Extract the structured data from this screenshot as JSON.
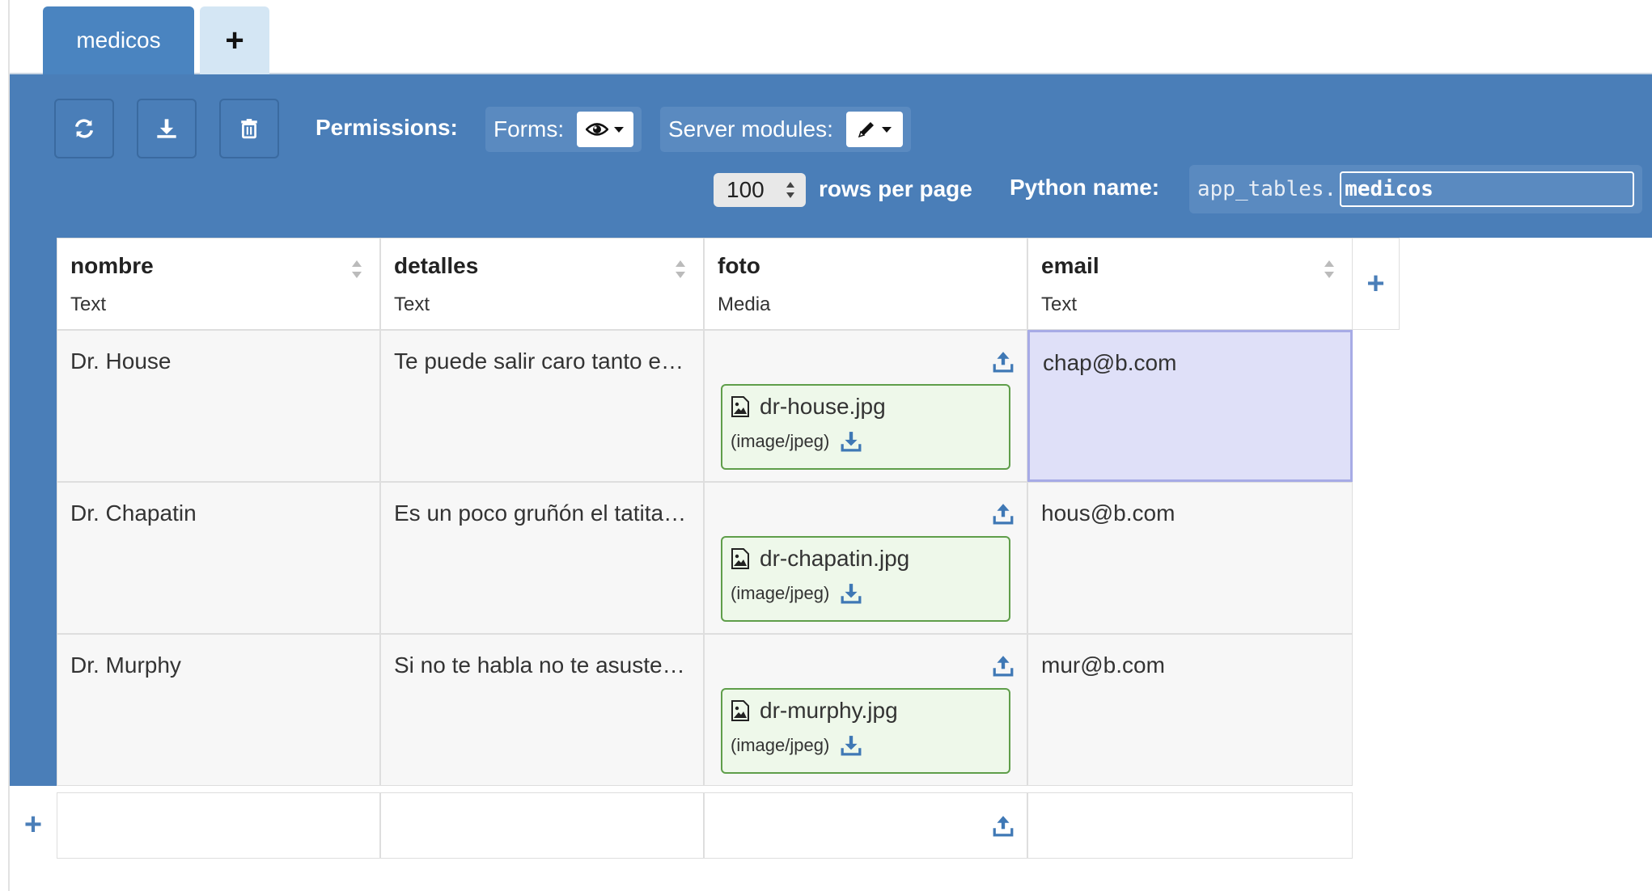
{
  "tabs": [
    {
      "label": "medicos",
      "active": true
    },
    {
      "label": "+",
      "active": false
    }
  ],
  "toolbar": {
    "refresh_icon": "refresh-icon",
    "download_icon": "download-icon",
    "delete_icon": "trash-icon",
    "permissions_label": "Permissions:",
    "forms_label": "Forms:",
    "forms_value_icon": "eye-icon",
    "server_modules_label": "Server modules:",
    "server_modules_value_icon": "pencil-icon",
    "rows_per_page_value": "100",
    "rows_per_page_label": "rows per page",
    "python_name_label": "Python name:",
    "python_prefix": "app_tables.",
    "python_name_value": "medicos"
  },
  "columns": [
    {
      "name": "nombre",
      "type": "Text",
      "sortable": true
    },
    {
      "name": "detalles",
      "type": "Text",
      "sortable": true
    },
    {
      "name": "foto",
      "type": "Media",
      "sortable": false
    },
    {
      "name": "email",
      "type": "Text",
      "sortable": true
    }
  ],
  "add_column_label": "+",
  "rows": [
    {
      "nombre": "Dr. House",
      "detalles": "Te puede salir caro tanto e…",
      "foto": {
        "name": "dr-house.jpg",
        "type": "(image/jpeg)"
      },
      "email": "chap@b.com",
      "selected_col": "email"
    },
    {
      "nombre": "Dr. Chapatin",
      "detalles": "Es un poco gruñón el tatita…",
      "foto": {
        "name": "dr-chapatin.jpg",
        "type": "(image/jpeg)"
      },
      "email": "hous@b.com"
    },
    {
      "nombre": "Dr. Murphy",
      "detalles": "Si no te habla no te asuste…",
      "foto": {
        "name": "dr-murphy.jpg",
        "type": "(image/jpeg)"
      },
      "email": "mur@b.com"
    }
  ],
  "add_row_label": "+",
  "colors": {
    "accent": "#4a7eb8",
    "tab_active": "#4a84c0",
    "tab_add": "#d4e6f4",
    "media_bg": "#eef8ea",
    "media_border": "#5f9e4a",
    "selected_cell": "#dfe0f8"
  }
}
